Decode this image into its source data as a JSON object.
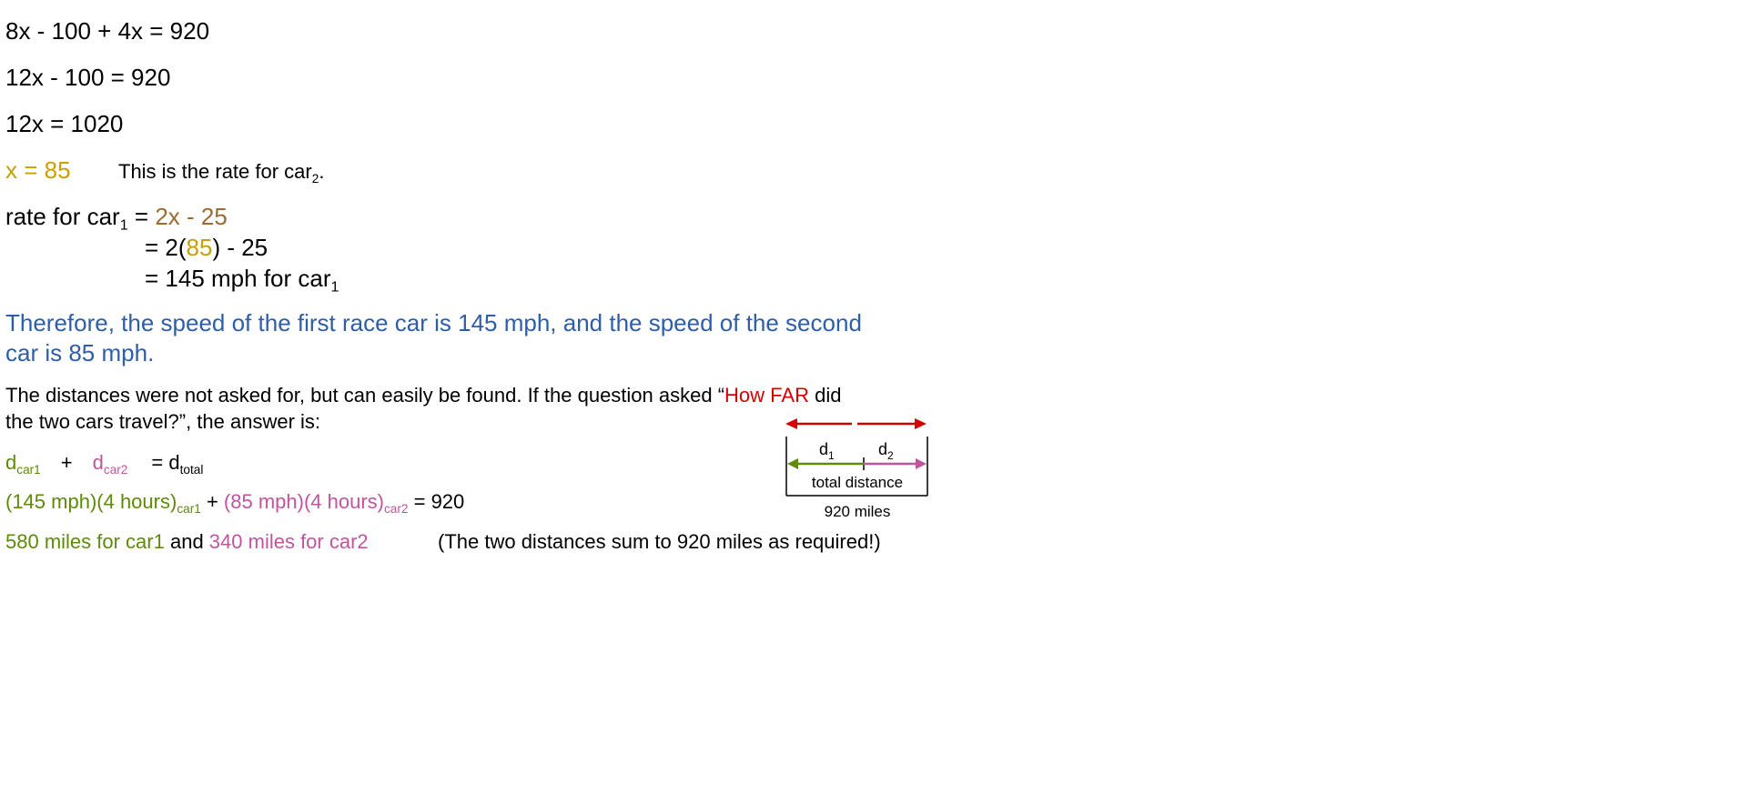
{
  "colors": {
    "gold": "#c8a000",
    "brown": "#9a6b32",
    "blue": "#2e5ea8",
    "red": "#d40000",
    "green": "#5d8a0a",
    "pink": "#c0559e",
    "black": "#000000"
  },
  "equations": {
    "line1": "8x - 100 + 4x = 920",
    "line2": "12x - 100 = 920",
    "line3": "12x = 1020",
    "x_value": "x = 85",
    "rate_note_pre": "This is the rate for car",
    "rate_note_sub": "2",
    "rate_note_post": "."
  },
  "rate_car1": {
    "label": "rate for car",
    "label_sub": "1",
    "eq": " = ",
    "expr": "2x - 25",
    "step2_pre": "= 2(",
    "step2_val": "85",
    "step2_post": ") - 25",
    "step3": "= 145 mph for car",
    "step3_sub": "1"
  },
  "conclusion": {
    "line1": "Therefore, the speed of the first race car is 145 mph, and the speed of the second",
    "line2": "car is 85 mph."
  },
  "distances": {
    "intro_pre": "The distances were not asked for, but can easily be found.  If the question asked “",
    "intro_red": "How FAR",
    "intro_post": " did",
    "intro_line2": "the two cars travel?”, the answer is:",
    "formula": {
      "d1": "d",
      "d1_sub": "car1",
      "plus": "+",
      "d2": "d",
      "d2_sub": "car2",
      "eq": "= d",
      "total_sub": "total"
    },
    "substituted": {
      "part1": "(145 mph)(4 hours)",
      "part1_sub": "car1",
      "plus": " + ",
      "part2": "(85 mph)(4 hours)",
      "part2_sub": "car2",
      "result": " = 920"
    },
    "answer": {
      "car1": "580 miles for car1",
      "and": " and ",
      "car2": "340 miles for car2",
      "note": "(The two distances sum to 920 miles as required!)"
    }
  },
  "diagram": {
    "d1": "d",
    "d1_sub": "1",
    "d2": "d",
    "d2_sub": "2",
    "box_label": "total distance",
    "total_label": "920 miles"
  }
}
